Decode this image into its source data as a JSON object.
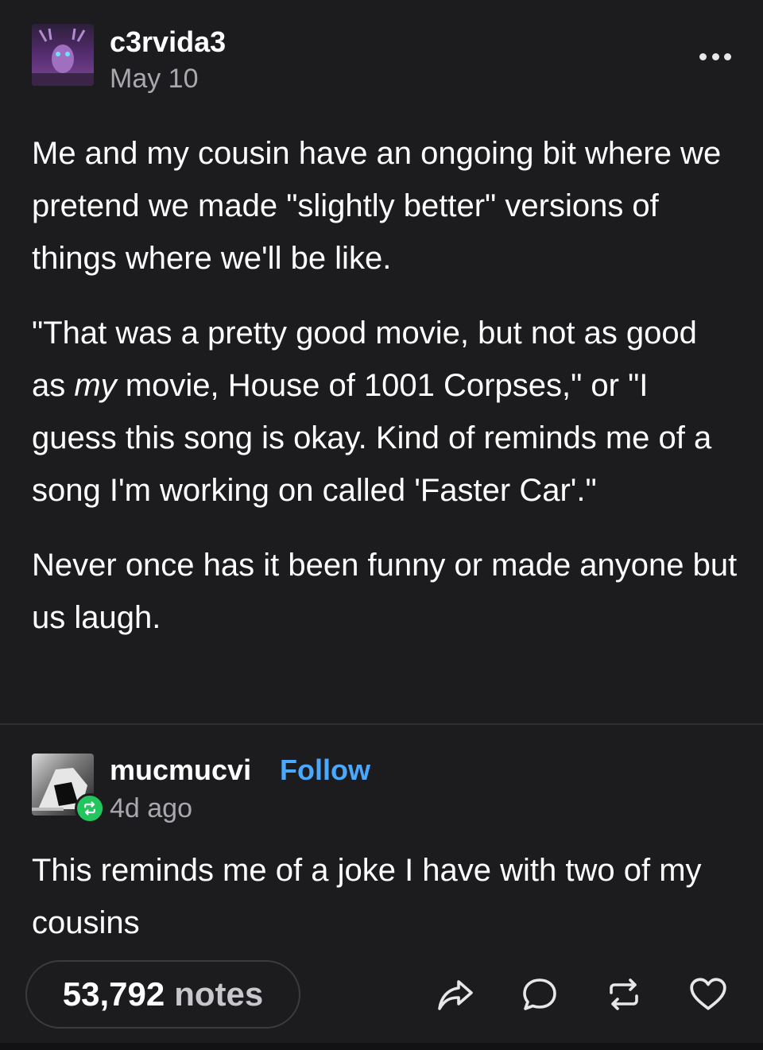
{
  "post": {
    "author": "c3rvida3",
    "date": "May 10",
    "paragraphs": {
      "p1": "Me and my cousin have an ongoing bit where we pretend we made \"slightly better\" versions of things where we'll be like.",
      "p2_before": "\"That was a pretty good movie, but not as good as ",
      "p2_em": "my",
      "p2_after": " movie, House of 1001 Corpses,\" or \"I guess this song is okay. Kind of reminds me of a song I'm working on called 'Faster Car'.\"",
      "p3": "Never once has it been funny or made anyone but us laugh."
    }
  },
  "reblog": {
    "author": "mucmucvi",
    "follow_label": "Follow",
    "time": "4d ago",
    "text": "This reminds me of a joke I have with two of my cousins"
  },
  "footer": {
    "notes_count": "53,792",
    "notes_label": "notes"
  },
  "icons": {
    "more": "more-options-icon",
    "share": "share-icon",
    "reply": "reply-icon",
    "reblog": "reblog-icon",
    "like": "heart-icon"
  },
  "colors": {
    "background": "#1c1c1e",
    "follow": "#4aa8ff",
    "reblog_badge": "#22c55e",
    "muted_text": "#a8a8ae"
  }
}
